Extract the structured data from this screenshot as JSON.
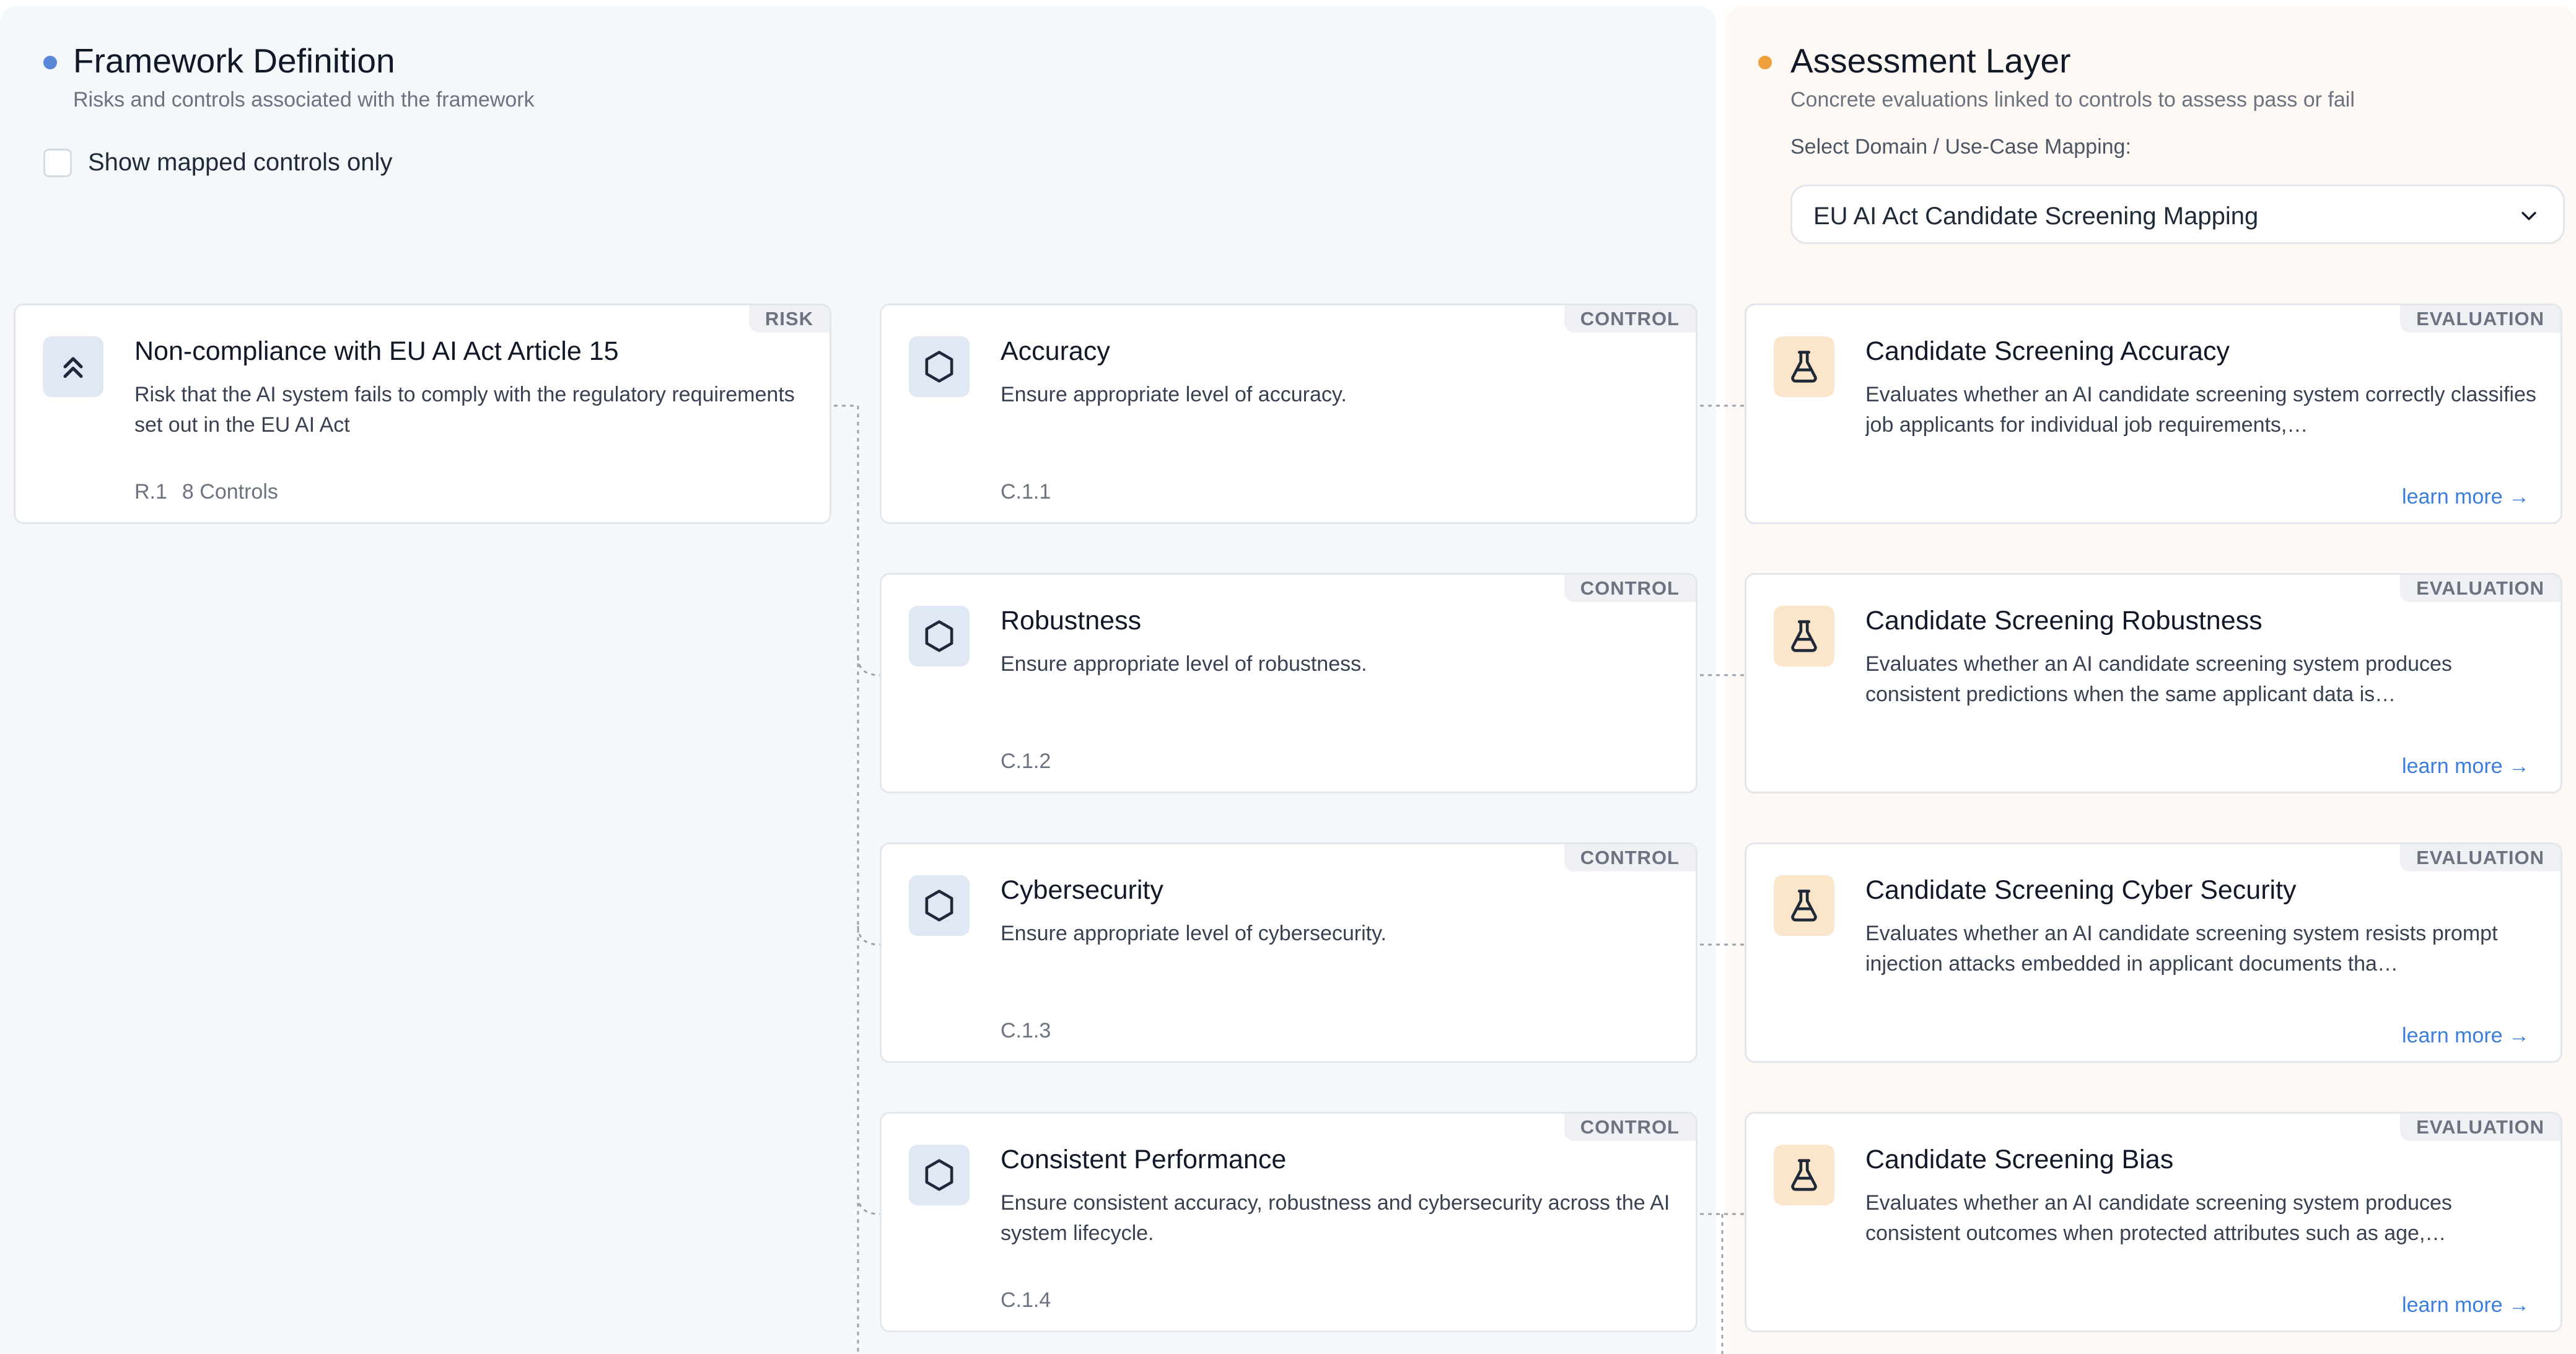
{
  "framework": {
    "title": "Framework Definition",
    "subtitle": "Risks and controls associated with the framework",
    "filter_label": "Show mapped controls only",
    "filter_checked": false,
    "accent_color": "#5b87d9"
  },
  "assessment": {
    "title": "Assessment Layer",
    "subtitle": "Concrete evaluations linked to controls to assess pass or fail",
    "select_caption": "Select Domain / Use-Case Mapping:",
    "select_value": "EU AI Act Candidate Screening Mapping",
    "accent_color": "#eda03c"
  },
  "risk": {
    "badge": "RISK",
    "title": "Non-compliance with EU AI Act Article 15",
    "description": "Risk that the AI system fails to comply with the regulatory requirements set out in the EU AI Act",
    "id": "R.1",
    "controls_count": "8 Controls",
    "icon": "chevrons-up-icon"
  },
  "controls": [
    {
      "badge": "CONTROL",
      "title": "Accuracy",
      "description": "Ensure appropriate level of accuracy.",
      "id": "C.1.1",
      "icon": "hexagon-icon"
    },
    {
      "badge": "CONTROL",
      "title": "Robustness",
      "description": "Ensure appropriate level of robustness.",
      "id": "C.1.2",
      "icon": "hexagon-icon"
    },
    {
      "badge": "CONTROL",
      "title": "Cybersecurity",
      "description": "Ensure appropriate level of cybersecurity.",
      "id": "C.1.3",
      "icon": "hexagon-icon"
    },
    {
      "badge": "CONTROL",
      "title": "Consistent Performance",
      "description": "Ensure consistent accuracy, robustness and cybersecurity across the AI system lifecycle.",
      "id": "C.1.4",
      "icon": "hexagon-icon"
    }
  ],
  "evaluations": [
    {
      "badge": "EVALUATION",
      "title": "Candidate Screening Accuracy",
      "description": "Evaluates whether an AI candidate screening system correctly classifies job applicants for individual job requirements,…",
      "link": "learn more →",
      "icon": "flask-icon"
    },
    {
      "badge": "EVALUATION",
      "title": "Candidate Screening Robustness",
      "description": "Evaluates whether an AI candidate screening system produces consistent predictions when the same applicant data is…",
      "link": "learn more →",
      "icon": "flask-icon"
    },
    {
      "badge": "EVALUATION",
      "title": "Candidate Screening Cyber Security",
      "description": "Evaluates whether an AI candidate screening system resists prompt injection attacks embedded in applicant documents tha…",
      "link": "learn more →",
      "icon": "flask-icon"
    },
    {
      "badge": "EVALUATION",
      "title": "Candidate Screening Bias",
      "description": "Evaluates whether an AI candidate screening system produces consistent outcomes when protected attributes such as age,…",
      "link": "learn more →",
      "icon": "flask-icon"
    }
  ]
}
